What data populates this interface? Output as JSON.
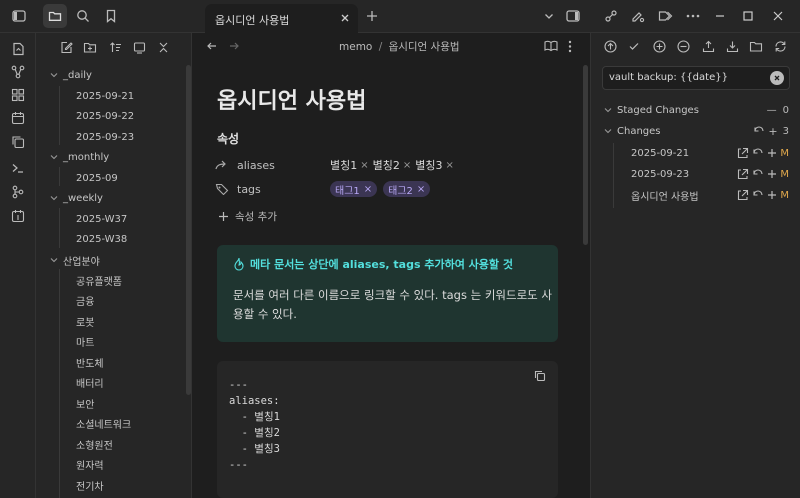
{
  "tab": {
    "title": "옵시디언 사용법"
  },
  "breadcrumb": {
    "folder": "memo",
    "sep": "/",
    "file": "옵시디언 사용법"
  },
  "note": {
    "title": "옵시디언 사용법",
    "properties_heading": "속성",
    "props": [
      {
        "key": "aliases",
        "values": [
          "별칭1",
          "별칭2",
          "별칭3"
        ]
      },
      {
        "key": "tags",
        "values": [
          "태그1",
          "태그2"
        ]
      }
    ],
    "add_property": "속성 추가",
    "callout_title": "메타 문서는 상단에 aliases, tags 추가하여 사용할 것",
    "callout_body": "문서를 여러 다른 이름으로 링크할 수 있다. tags 는 키워드로도 사용할 수 있다.",
    "code": "---\naliases:\n  - 별칭1\n  - 별칭2\n  - 별칭3\n---"
  },
  "tree": {
    "folders": [
      {
        "name": "_daily",
        "files": [
          "2025-09-21",
          "2025-09-22",
          "2025-09-23"
        ]
      },
      {
        "name": "_monthly",
        "files": [
          "2025-09"
        ]
      },
      {
        "name": "_weekly",
        "files": [
          "2025-W37",
          "2025-W38"
        ]
      },
      {
        "name": "산업분야",
        "files": [
          "공유플랫폼",
          "금융",
          "로봇",
          "마트",
          "반도체",
          "배터리",
          "보안",
          "소셜네트워크",
          "소형원전",
          "원자력",
          "전기차"
        ]
      }
    ]
  },
  "git": {
    "commit_message": "vault backup: {{date}}",
    "staged_label": "Staged Changes",
    "staged_count": "0",
    "staged_minus": "—",
    "changes_label": "Changes",
    "changes_count": "3",
    "changes_plus": "+",
    "files": [
      {
        "name": "2025-09-21",
        "status": "M"
      },
      {
        "name": "2025-09-23",
        "status": "M"
      },
      {
        "name": "옵시디언 사용법",
        "status": "M"
      }
    ]
  },
  "colors": {
    "accent": "#7f6df2",
    "modified": "#e0a84c",
    "callout_title": "#53dfdd"
  }
}
